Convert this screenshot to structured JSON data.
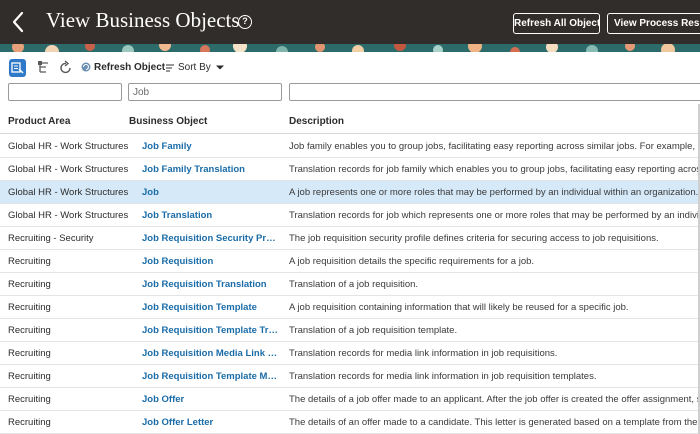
{
  "header": {
    "title": "View Business Objects",
    "help_glyph": "?",
    "refresh_all_label": "Refresh All Objects",
    "view_process_label": "View Process Results"
  },
  "toolbar": {
    "refresh_object_label": "Refresh Object",
    "sort_by_label": "Sort By"
  },
  "filters": {
    "product_area_value": "",
    "business_object_value": "Job",
    "description_value": ""
  },
  "table": {
    "columns": {
      "product_area": "Product Area",
      "business_object": "Business Object",
      "description": "Description"
    },
    "rows": [
      {
        "area": "Global HR - Work Structures",
        "object": "Job Family",
        "description": "Job family enables you to group jobs, facilitating easy reporting across similar jobs. For example, you can"
      },
      {
        "area": "Global HR - Work Structures",
        "object": "Job Family Translation",
        "description": "Translation records for job family which enables you to group jobs, facilitating easy reporting across simi"
      },
      {
        "area": "Global HR - Work Structures",
        "object": "Job",
        "description": "A job represents one or more roles that may be performed by an individual within an organization."
      },
      {
        "area": "Global HR - Work Structures",
        "object": "Job Translation",
        "description": "Translation records for job which represents one or more roles that may be performed by an individual w"
      },
      {
        "area": "Recruiting - Security",
        "object": "Job Requisition Security Profile",
        "description": "The job requisition security profile defines criteria for securing access to job requisitions."
      },
      {
        "area": "Recruiting",
        "object": "Job Requisition",
        "description": "A job requisition details the specific requirements for a job."
      },
      {
        "area": "Recruiting",
        "object": "Job Requisition Translation",
        "description": "Translation of a job requisition."
      },
      {
        "area": "Recruiting",
        "object": "Job Requisition Template",
        "description": "A job requisition containing information that will likely be reused for a specific job."
      },
      {
        "area": "Recruiting",
        "object": "Job Requisition Template Transl...",
        "description": "Translation of a job requisition template."
      },
      {
        "area": "Recruiting",
        "object": "Job Requisition Media Link Tran...",
        "description": "Translation records for media link information in job requisitions."
      },
      {
        "area": "Recruiting",
        "object": "Job Requisition Template Media...",
        "description": "Translation records for media link information in job requisition templates."
      },
      {
        "area": "Recruiting",
        "object": "Job Offer",
        "description": "The details of a job offer made to an applicant. After the job offer is created the offer assignment, salary,"
      },
      {
        "area": "Recruiting",
        "object": "Job Offer Letter",
        "description": "The details of an offer made to a candidate. This letter is generated based on a template from the conte"
      }
    ]
  },
  "colors": {
    "header_bg": "#312d2a",
    "link": "#1a6ca8",
    "selected_row": "#d6e9f8",
    "primary_icon": "#2f79c9"
  },
  "icons": [
    "back-chevron-icon",
    "help-icon",
    "select-mode-icon",
    "tree-icon",
    "refresh-icon",
    "refresh-object-icon",
    "sort-icon",
    "dropdown-caret-icon"
  ]
}
